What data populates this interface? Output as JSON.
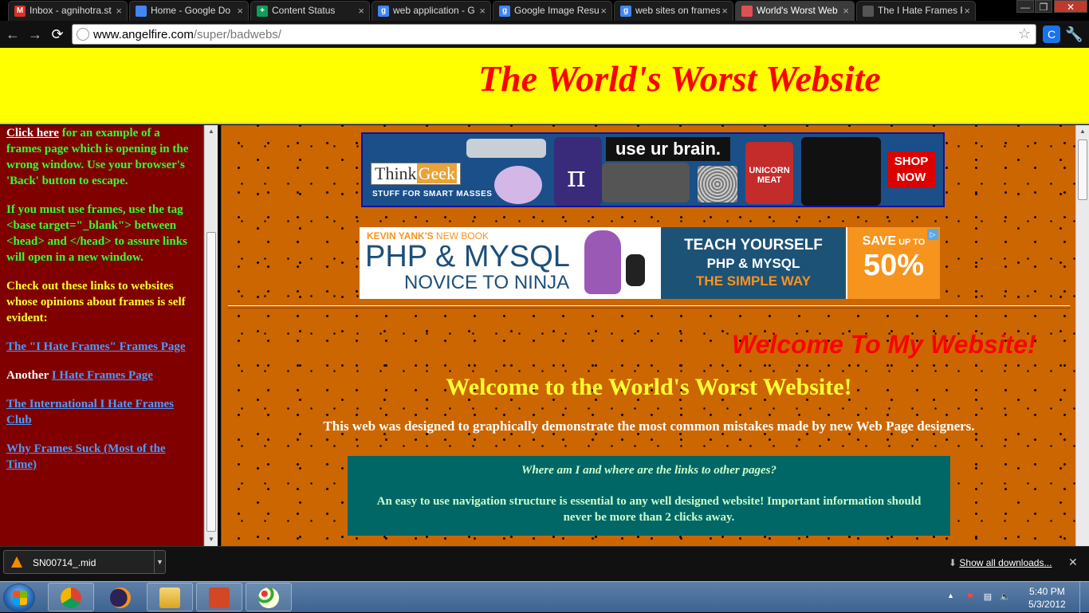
{
  "tabs": [
    {
      "title": "Inbox - agnihotra.st",
      "favicon": "gmail-icon",
      "glyph": "M",
      "color": "#d93025",
      "active": false
    },
    {
      "title": "Home - Google Do",
      "favicon": "google-docs-icon",
      "glyph": "",
      "color": "#4285f4",
      "active": false
    },
    {
      "title": "Content Status",
      "favicon": "google-sheets-icon",
      "glyph": "+",
      "color": "#0f9d58",
      "active": false
    },
    {
      "title": "web application - G",
      "favicon": "google-icon",
      "glyph": "g",
      "color": "#4285f4",
      "active": false
    },
    {
      "title": "Google Image Resu",
      "favicon": "google-icon",
      "glyph": "g",
      "color": "#4285f4",
      "active": false
    },
    {
      "title": "web sites on frames",
      "favicon": "google-icon",
      "glyph": "g",
      "color": "#4285f4",
      "active": false
    },
    {
      "title": "World's Worst Web",
      "favicon": "angelfire-icon",
      "glyph": "",
      "color": "#e05050",
      "active": true
    },
    {
      "title": "The I Hate Frames F",
      "favicon": "globe-icon",
      "glyph": "",
      "color": "#555555",
      "active": false
    }
  ],
  "address_bar": {
    "domain": "www.angelfire.com",
    "path": "/super/badwebs/"
  },
  "header": {
    "title": "The World's Worst Website"
  },
  "sidebar": {
    "click_here": "Click here",
    "click_here_rest": " for an example of a frames page which is opening in the wrong window. Use your browser's 'Back' button to escape.",
    "frames_tip": "If you must use frames, use the tag <base target=\"_blank\"> between <head> and </head> to assure links will open in a new window.",
    "check_out": "Check out these links to websites whose opinions about frames is self evident:",
    "link1": "The \"I Hate Frames\" Frames Page",
    "another": "Another ",
    "link2": "I Hate Frames Page",
    "link3": "The International I Hate Frames Club",
    "link4": "Why Frames Suck (Most of the Time)"
  },
  "ad_thinkgeek": {
    "logo_think": "Think",
    "logo_geek": "Geek",
    "tagline": "STUFF FOR SMART MASSES",
    "headline": "use ur brain.",
    "unicorn": "UNICORN MEAT",
    "shop_now": "SHOP NOW"
  },
  "ad_php": {
    "kicker_author": "KEVIN YANK'S",
    "kicker_rest": " NEW BOOK",
    "title": "PHP & MYSQL",
    "subtitle": "NOVICE TO NINJA",
    "teach_line1": "TEACH YOURSELF",
    "teach_line2": "PHP & MYSQL",
    "teach_line3": "THE SIMPLE WAY",
    "save": "SAVE",
    "save_up_to": " UP TO",
    "percent": "50%"
  },
  "main": {
    "welcome_italic": "Welcome To My Website!",
    "welcome_heading": "Welcome to the World's Worst Website!",
    "intro": "This web was designed to graphically demonstrate the most common mistakes made by new Web Page designers.",
    "box_question": "Where am I and where are the links to other pages?",
    "box_answer": "An easy to use navigation structure is essential to any well designed website! Important information should never be more than 2 clicks away."
  },
  "downloads": {
    "file_name": "SN00714_.mid",
    "show_all": "Show all downloads..."
  },
  "taskbar": {
    "time": "5:40 PM",
    "date": "5/3/2012",
    "apps": [
      "chrome-icon",
      "eclipse-icon",
      "explorer-icon",
      "powerpoint-icon",
      "paint-icon"
    ]
  },
  "colors": {
    "header_bg": "#ffff00",
    "header_title": "#ff0000",
    "sidebar_bg": "#800000",
    "main_bg": "#cc6600",
    "info_box_bg": "#006666"
  }
}
